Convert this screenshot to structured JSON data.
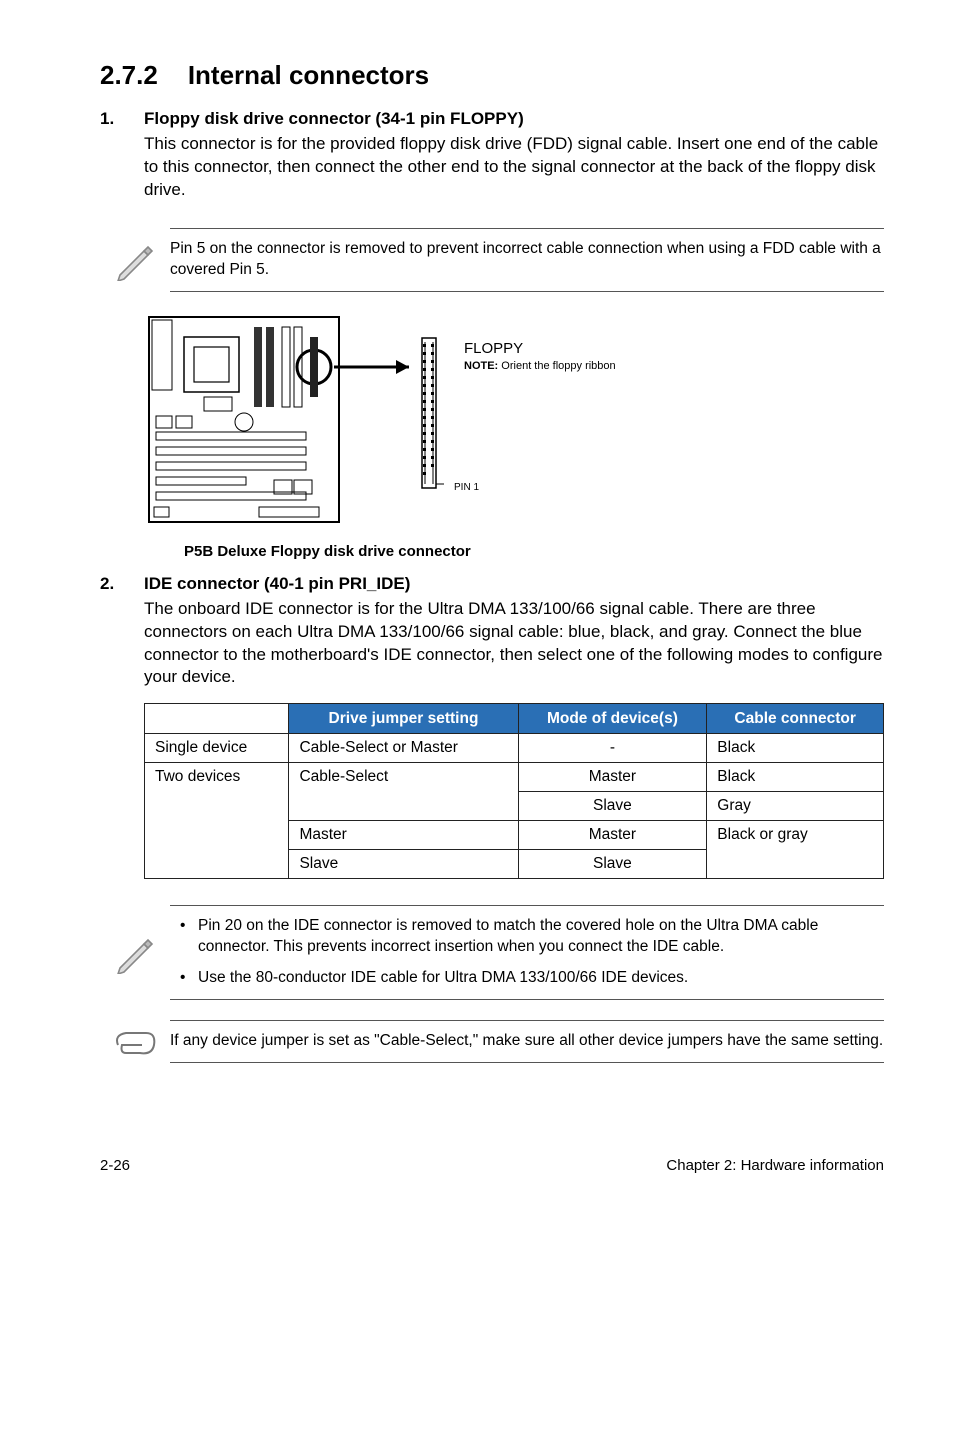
{
  "section": {
    "number": "2.7.2",
    "title": "Internal connectors"
  },
  "items": [
    {
      "num": "1.",
      "title": "Floppy disk drive connector (34-1 pin FLOPPY)",
      "body": "This connector is for the provided floppy disk drive (FDD) signal cable. Insert one end of the cable to this connector, then connect the other end to the signal connector at the back of the floppy disk drive."
    },
    {
      "num": "2.",
      "title": "IDE connector (40-1 pin PRI_IDE)",
      "body": "The onboard IDE connector is for the Ultra DMA 133/100/66 signal cable. There are three connectors on each Ultra DMA 133/100/66 signal cable: blue, black, and gray. Connect the blue connector to the motherboard's IDE connector, then select one of the following modes to configure your device."
    }
  ],
  "note1": "Pin 5 on the connector is removed to prevent incorrect cable connection when using a FDD cable with a covered Pin 5.",
  "diagram": {
    "floppy_label": "FLOPPY",
    "note_bold": "NOTE:",
    "note_rest": "Orient the floppy ribbon",
    "pin": "PIN 1",
    "caption": "P5B Deluxe Floppy disk drive connector"
  },
  "table": {
    "headers": [
      "",
      "Drive jumper setting",
      "Mode of device(s)",
      "Cable connector"
    ],
    "rows": [
      [
        "Single device",
        "Cable-Select or Master",
        "-",
        "Black"
      ],
      [
        "Two devices",
        "Cable-Select",
        "Master",
        "Black"
      ],
      [
        "",
        "",
        "Slave",
        "Gray"
      ],
      [
        "",
        "Master",
        "Master",
        "Black or gray"
      ],
      [
        "",
        "Slave",
        "Slave",
        ""
      ]
    ]
  },
  "note2_items": [
    "Pin 20 on the IDE connector is removed to match the covered hole on the Ultra DMA cable connector. This prevents incorrect insertion when you connect the IDE cable.",
    "Use the 80-conductor IDE cable for Ultra DMA 133/100/66 IDE devices."
  ],
  "note3": "If any device jumper is set as \"Cable-Select,\" make sure all other device jumpers have the same setting.",
  "footer": {
    "page": "2-26",
    "chapter": "Chapter 2: Hardware information"
  }
}
